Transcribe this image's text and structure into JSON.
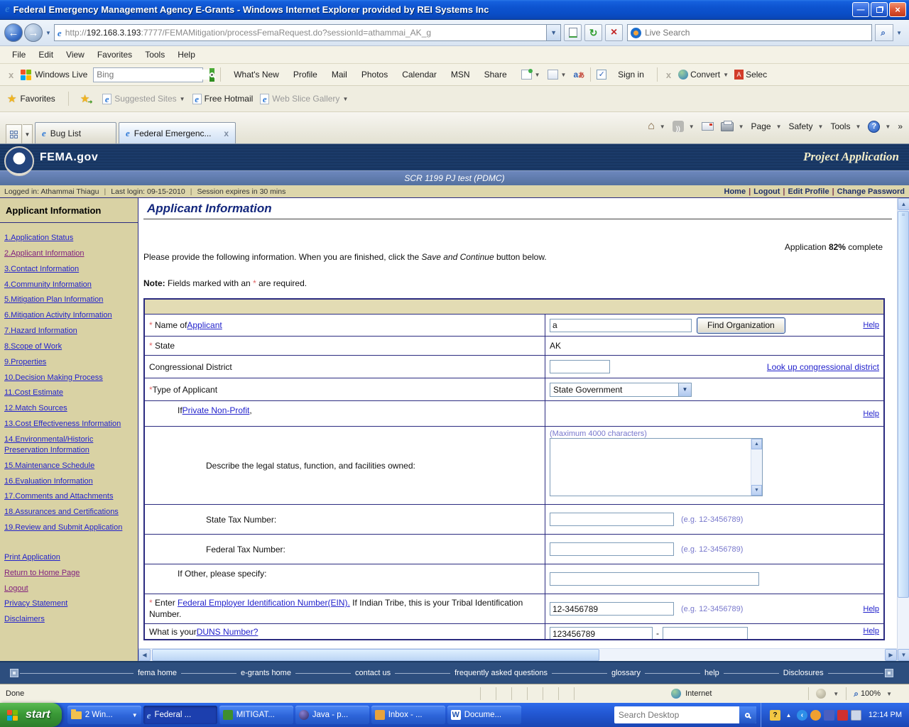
{
  "window": {
    "title": "Federal Emergency Management Agency E-Grants - Windows Internet Explorer provided by REI Systems Inc"
  },
  "address_bar": {
    "url_scheme": "http://",
    "url_host": "192.168.3.193",
    "url_rest": ":7777/FEMAMitigation/processFemaRequest.do?sessionId=athammai_AK_g",
    "search_placeholder": "Live Search"
  },
  "menu_bar": [
    "File",
    "Edit",
    "View",
    "Favorites",
    "Tools",
    "Help"
  ],
  "live_toolbar": {
    "brand": "Windows Live",
    "search_placeholder": "Bing",
    "links": [
      "What's New",
      "Profile",
      "Mail",
      "Photos",
      "Calendar",
      "MSN",
      "Share"
    ],
    "sign_in": "Sign in",
    "convert": "Convert",
    "select": "Selec"
  },
  "favorites_bar": {
    "label": "Favorites",
    "suggested_sites": "Suggested Sites",
    "free_hotmail": "Free Hotmail",
    "web_slice": "Web Slice Gallery"
  },
  "tab_bar": {
    "tab1": "Bug List",
    "tab2": "Federal Emergenc...",
    "page": "Page",
    "safety": "Safety",
    "tools": "Tools"
  },
  "site_header": {
    "brand": "FEMA.gov",
    "app_title": "Project Application",
    "subtitle": "SCR 1199 PJ test (PDMC)",
    "logged_in": "Logged in: Athammai Thiagu",
    "last_login": "Last login: 09-15-2010",
    "session": "Session expires in 30 mins",
    "nav_home": "Home",
    "nav_logout": "Logout",
    "nav_edit_profile": "Edit Profile",
    "nav_change_password": "Change Password"
  },
  "sidebar": {
    "title": "Applicant Information",
    "links": [
      "1.Application Status",
      "2.Applicant Information",
      "3.Contact Information",
      "4.Community Information",
      "5.Mitigation Plan Information",
      "6.Mitigation Activity Information",
      "7.Hazard Information",
      "8.Scope of Work",
      "9.Properties",
      "10.Decision Making Process",
      "11.Cost Estimate",
      "12.Match Sources",
      "13.Cost Effectiveness Information",
      "14.Environmental/Historic Preservation Information",
      "15.Maintenance Schedule",
      "16.Evaluation Information",
      "17.Comments and Attachments",
      "18.Assurances and Certifications",
      "19.Review and Submit Application"
    ],
    "extra_links": [
      "Print Application",
      "Return to Home Page",
      "Logout",
      "Privacy Statement",
      "Disclaimers"
    ]
  },
  "main": {
    "heading": "Applicant Information",
    "progress_prefix": "Application ",
    "progress_percent": "82%",
    "progress_suffix": " complete",
    "intro_pre": "Please provide the following information. When you are finished, click the ",
    "intro_italic": "Save and Continue",
    "intro_post": " button below.",
    "note_label": "Note:",
    "note_pre": " Fields marked with an ",
    "note_star": "*",
    "note_post": " are required.",
    "form": {
      "required_star": "*",
      "name_label_pre": "Name of ",
      "name_link": "Applicant",
      "name_value": "a",
      "find_org_button": "Find Organization",
      "help": "Help",
      "state_label": "State",
      "state_value": "AK",
      "congress_label": "Congressional District",
      "congress_link": "Look up congressional district",
      "type_label": "Type of Applicant",
      "type_value": "State Government",
      "pnp_pre": "If ",
      "pnp_link": "Private Non-Profit",
      "pnp_post": ",",
      "legal_label": "Describe the legal status, function, and facilities owned:",
      "legal_max": "(Maximum 4000 characters)",
      "state_tax_label": "State Tax Number:",
      "fed_tax_label": "Federal Tax Number:",
      "tax_example": "(e.g. 12-3456789)",
      "other_label": "If Other, please specify:",
      "ein_pre": "Enter ",
      "ein_link": "Federal Employer Identification Number(EIN).",
      "ein_post": " If Indian Tribe, this is your Tribal Identification Number.",
      "ein_value": "12-3456789",
      "ein_example": "(e.g. 12-3456789)",
      "duns_pre": "What is your ",
      "duns_link": "DUNS Number?",
      "duns_value": "123456789"
    }
  },
  "footer": {
    "links": [
      "fema home",
      "e-grants home",
      "contact us",
      "frequently asked questions",
      "glossary",
      "help",
      "Disclosures"
    ]
  },
  "status_bar": {
    "status": "Done",
    "zone": "Internet",
    "zoom": "100%"
  },
  "taskbar": {
    "start": "start",
    "buttons": [
      "2 Win...",
      "Federal ...",
      "MITIGAT...",
      "Java - p...",
      "Inbox - ...",
      "Docume..."
    ],
    "search_placeholder": "Search Desktop",
    "time": "12:14 PM"
  }
}
